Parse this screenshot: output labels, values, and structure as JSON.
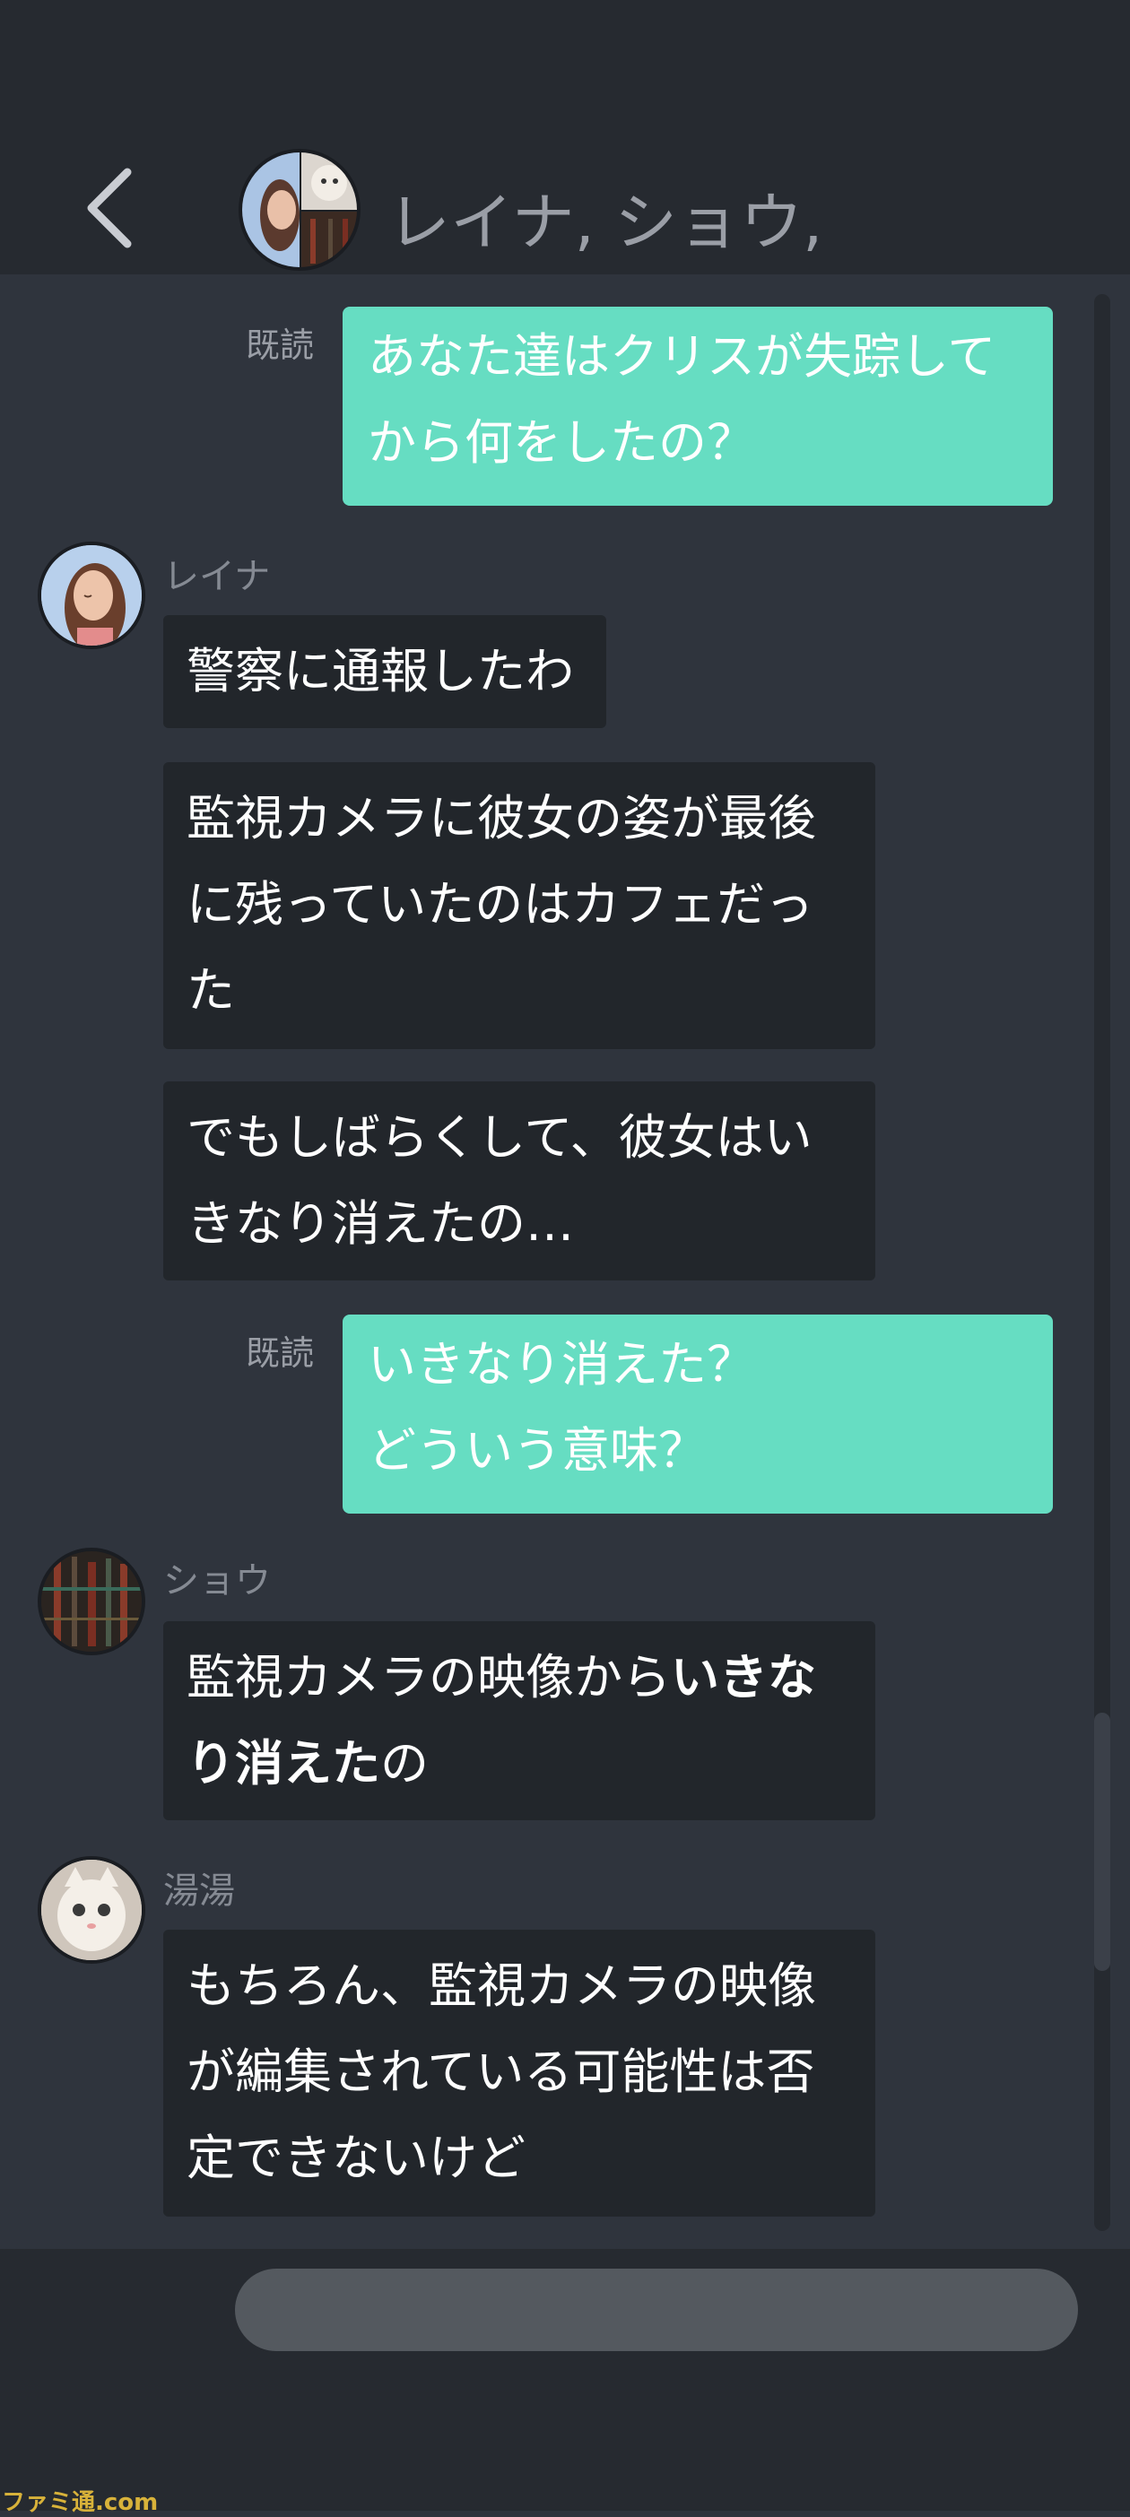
{
  "header": {
    "title": "レイナ, ショウ,"
  },
  "messages": {
    "m1": {
      "read": "既読",
      "lines": "あなた達はクリスが失踪して\nから何をしたの？"
    },
    "reina": {
      "name": "レイナ",
      "b1": "警察に通報したわ",
      "b2": "監視カメラに彼女の姿が最後\nに残っていたのはカフェだっ\nた",
      "b3": "でもしばらくして、彼女はい\nきなり消えたの…"
    },
    "m2": {
      "read": "既読",
      "lines": "いきなり消えた？\nどういう意味？"
    },
    "shou": {
      "name": "ショウ",
      "b1_part1": "監視カメラの映像から",
      "b1_bold1": "いきな",
      "b1_bold2": "り消えた",
      "b1_part2": "の"
    },
    "tangtang": {
      "name": "湯湯",
      "b1": "もちろん、監視カメラの映像\nが編集されている可能性は否\n定できないけど"
    }
  },
  "watermark": "ファミ通.com",
  "colors": {
    "outgoing_bubble": "#66ddc2",
    "incoming_bubble": "#22262b",
    "background": "#2f343d",
    "header": "#262a30"
  }
}
